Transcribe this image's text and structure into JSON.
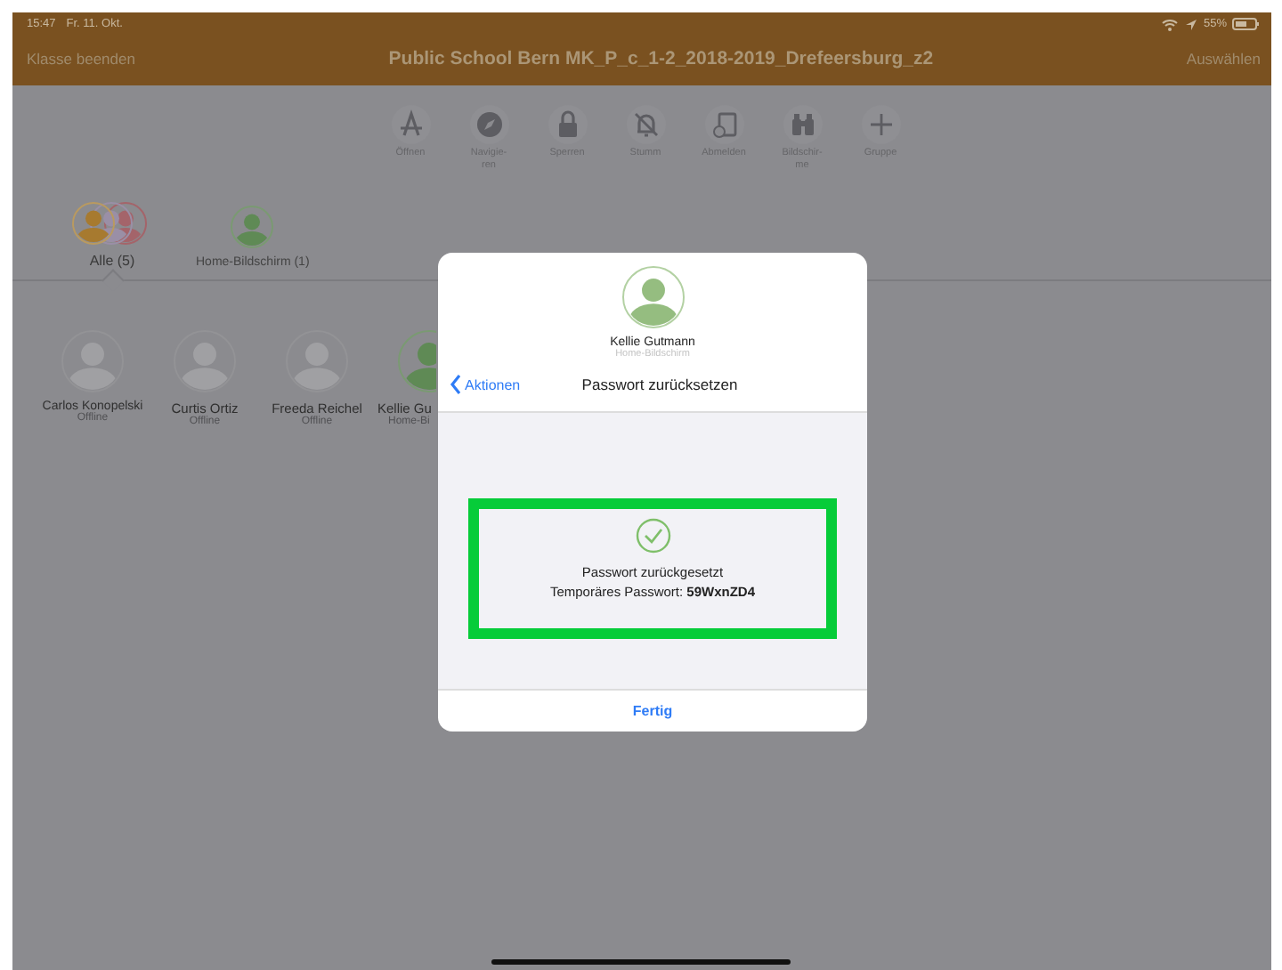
{
  "status_bar": {
    "time": "15:47",
    "date": "Fr. 11. Okt.",
    "battery": "55%"
  },
  "nav": {
    "left": "Klasse beenden",
    "title": "Public School Bern MK_P_c_1-2_2018-2019_Drefeersburg_z2",
    "right": "Auswählen"
  },
  "toolbar": [
    {
      "label": "Öffnen"
    },
    {
      "label": "Navigie-\nren"
    },
    {
      "label": "Sperren"
    },
    {
      "label": "Stumm"
    },
    {
      "label": "Abmelden"
    },
    {
      "label": "Bildschir-\nme"
    },
    {
      "label": "Gruppe"
    }
  ],
  "groups": [
    {
      "label": "Alle (5)",
      "selected": true,
      "kind": "all"
    },
    {
      "label": "Home-Bildschirm (1)",
      "selected": false,
      "kind": "home"
    }
  ],
  "students": [
    {
      "name": "Carlos Konopelski",
      "status": "Offline",
      "kind": "offline"
    },
    {
      "name": "Curtis Ortiz",
      "status": "Offline",
      "kind": "offline"
    },
    {
      "name": "Freeda Reichel",
      "status": "Offline",
      "kind": "offline"
    },
    {
      "name": "Kellie Gu",
      "status": "Home-Bi",
      "kind": "home"
    }
  ],
  "dialog": {
    "name": "Kellie Gutmann",
    "status": "Home-Bildschirm",
    "back": "Aktionen",
    "title": "Passwort zurücksetzen",
    "message": "Passwort zurückgesetzt",
    "password_label": "Temporäres Passwort:",
    "password": "59WxnZD4",
    "done": "Fertig"
  }
}
